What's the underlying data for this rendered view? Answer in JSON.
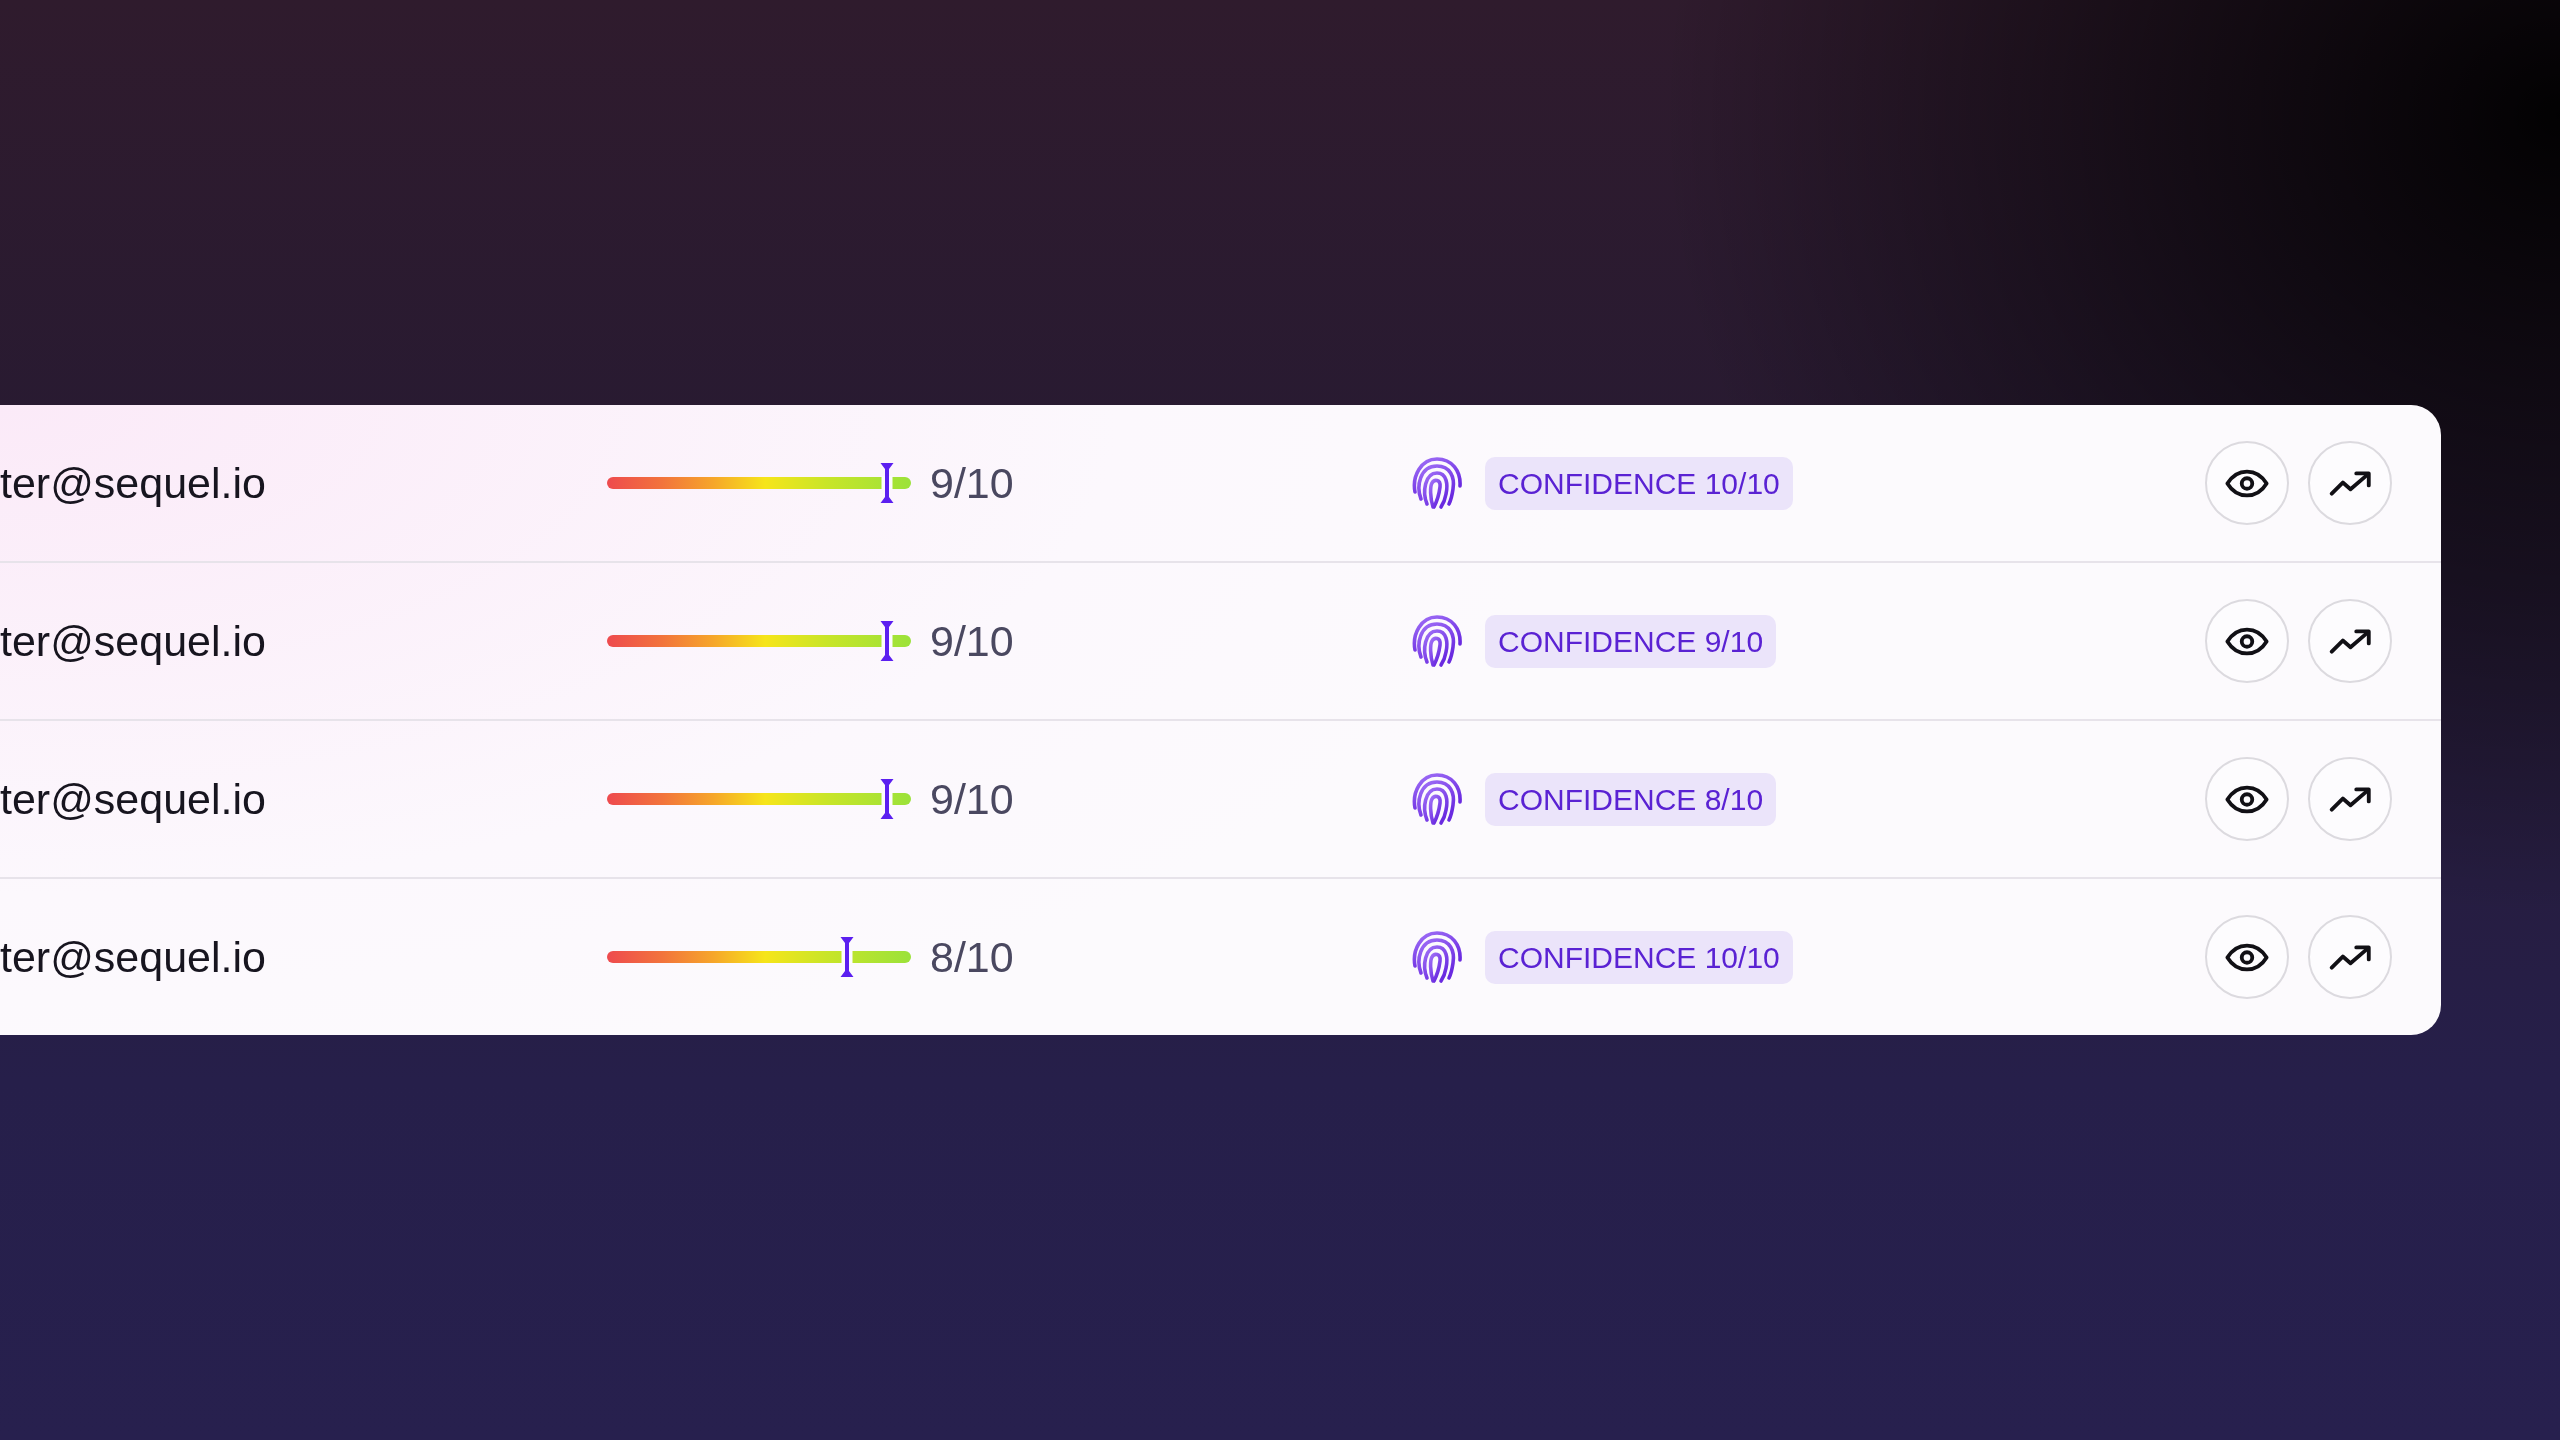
{
  "rows": [
    {
      "email": "ter@sequel.io",
      "score": {
        "level": 0.92,
        "reading": "9/10"
      },
      "confidence": "CONFIDENCE 10/10"
    },
    {
      "email": "ter@sequel.io",
      "score": {
        "level": 0.92,
        "reading": "9/10"
      },
      "confidence": "CONFIDENCE 9/10"
    },
    {
      "email": "ter@sequel.io",
      "score": {
        "level": 0.92,
        "reading": "9/10"
      },
      "confidence": "CONFIDENCE 8/10"
    },
    {
      "email": "ter@sequel.io",
      "score": {
        "level": 0.79,
        "reading": "8/10"
      },
      "confidence": "CONFIDENCE 10/10"
    }
  ]
}
